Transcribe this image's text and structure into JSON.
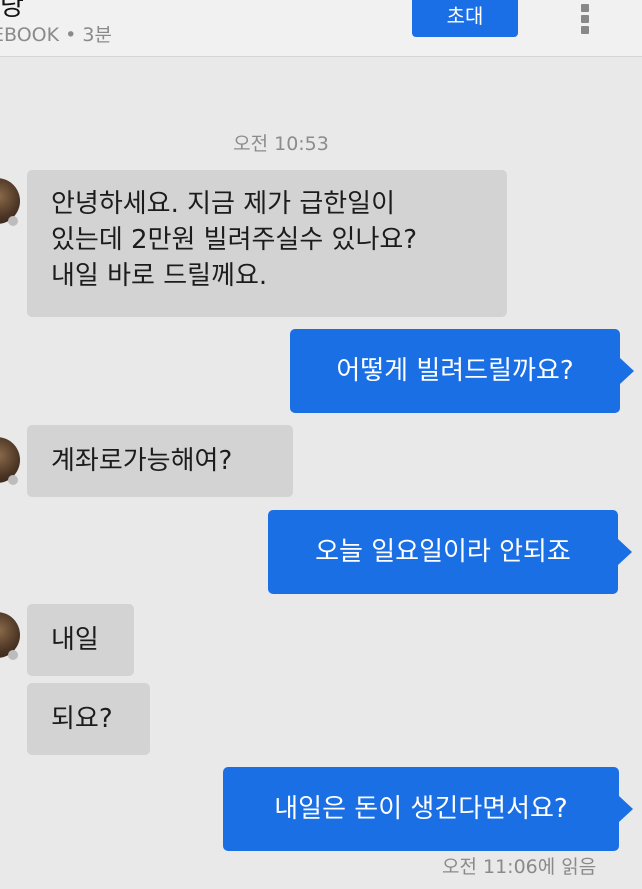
{
  "header": {
    "contact_name": "낭",
    "contact_source": "EBOOK • 3분",
    "invite_label": "초대",
    "menu_icon": "overflow-menu-icon"
  },
  "thread": {
    "timestamp": "오전 10:53",
    "messages": [
      {
        "sender": "them",
        "text": "안녕하세요. 지금 제가 급한일이\n있는데 2만원 빌려주실수 있나요?\n내일 바로 드릴께요."
      },
      {
        "sender": "me",
        "text": "어떻게 빌려드릴까요?"
      },
      {
        "sender": "them",
        "text": "계좌로가능해여?"
      },
      {
        "sender": "me",
        "text": "오늘 일요일이라 안되죠"
      },
      {
        "sender": "them",
        "text": "내일"
      },
      {
        "sender": "them",
        "text": "되요?"
      },
      {
        "sender": "me",
        "text": "내일은 돈이 생긴다면서요?"
      }
    ],
    "read_receipt": "오전 11:06에 읽음"
  },
  "colors": {
    "outgoing_bubble": "#1b6fe5",
    "incoming_bubble": "#d3d3d3",
    "background": "#e9e9e9"
  }
}
